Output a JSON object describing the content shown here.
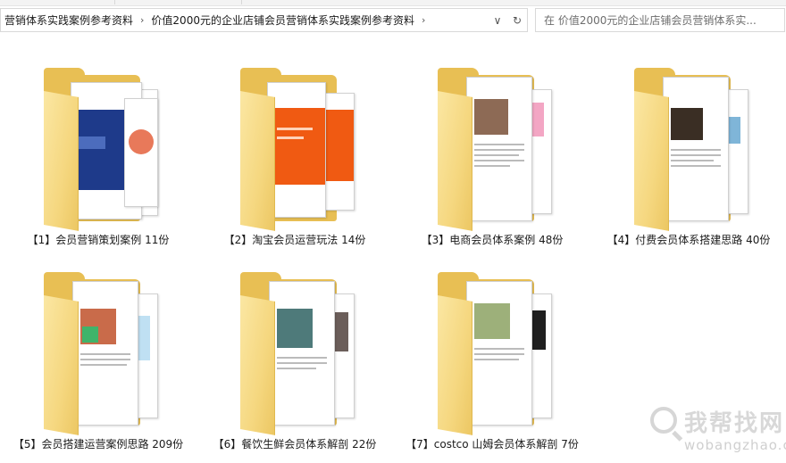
{
  "address_bar": {
    "crumbs": [
      "营销体系实践案例参考资料",
      "价值2000元的企业店铺会员营销体系实践案例参考资料"
    ],
    "separator": "›",
    "chevron_down": "∨",
    "refresh": "↻"
  },
  "search": {
    "placeholder": "在 价值2000元的企业店铺会员营销体系实..."
  },
  "items": [
    {
      "label": "【1】会员营销策划案例  11份",
      "preview": "blue-slides"
    },
    {
      "label": "【2】淘宝会员运营玩法 14份",
      "preview": "orange-slides"
    },
    {
      "label": "【3】电商会员体系案例  48份",
      "preview": "document"
    },
    {
      "label": "【4】付费会员体系搭建思路  40份",
      "preview": "document"
    },
    {
      "label": "【5】会员搭建运营案例思路  209份",
      "preview": "document"
    },
    {
      "label": "【6】餐饮生鲜会员体系解剖  22份",
      "preview": "document"
    },
    {
      "label": "【7】costco 山姆会员体系解剖 7份",
      "preview": "document"
    }
  ],
  "watermark": {
    "cn": "我帮找网",
    "url": "wobangzhao.com"
  },
  "colors": {
    "folder": "#e8bf54",
    "folder_front": "#f5d77f",
    "blue_slide": "#1e3a8a",
    "orange_slide": "#f05a12"
  }
}
